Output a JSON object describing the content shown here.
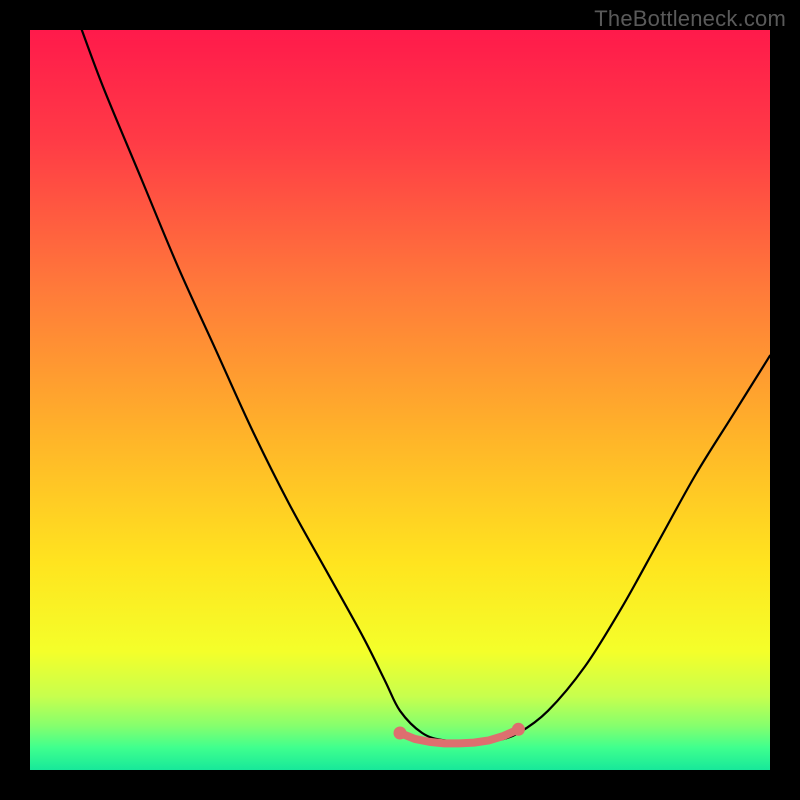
{
  "watermark": "TheBottleneck.com",
  "colors": {
    "frame": "#000000",
    "curve": "#000000",
    "marker_stroke": "#dd6f6f",
    "marker_fill": "#dd6f6f",
    "gradient_stops": [
      {
        "offset": 0.0,
        "color": "#ff1a4b"
      },
      {
        "offset": 0.15,
        "color": "#ff3b46"
      },
      {
        "offset": 0.35,
        "color": "#ff7a3a"
      },
      {
        "offset": 0.55,
        "color": "#ffb429"
      },
      {
        "offset": 0.72,
        "color": "#ffe41f"
      },
      {
        "offset": 0.84,
        "color": "#f4ff2a"
      },
      {
        "offset": 0.9,
        "color": "#c8ff4d"
      },
      {
        "offset": 0.94,
        "color": "#86ff6d"
      },
      {
        "offset": 0.97,
        "color": "#3fff8e"
      },
      {
        "offset": 1.0,
        "color": "#17e89a"
      }
    ]
  },
  "chart_data": {
    "type": "line",
    "title": "",
    "xlabel": "",
    "ylabel": "",
    "xlim": [
      0,
      100
    ],
    "ylim": [
      0,
      100
    ],
    "grid": false,
    "legend": false,
    "series": [
      {
        "name": "bottleneck-curve",
        "x": [
          7,
          10,
          15,
          20,
          25,
          30,
          35,
          40,
          45,
          48,
          50,
          53,
          56,
          60,
          63,
          66,
          70,
          75,
          80,
          85,
          90,
          95,
          100
        ],
        "y": [
          100,
          92,
          80,
          68,
          57,
          46,
          36,
          27,
          18,
          12,
          8,
          5,
          4,
          4,
          4,
          5,
          8,
          14,
          22,
          31,
          40,
          48,
          56
        ]
      }
    ],
    "markers": {
      "name": "trough-highlight",
      "color": "#dd6f6f",
      "points": [
        {
          "x": 50,
          "y": 5
        },
        {
          "x": 52,
          "y": 4.2
        },
        {
          "x": 54,
          "y": 3.8
        },
        {
          "x": 56,
          "y": 3.6
        },
        {
          "x": 58,
          "y": 3.6
        },
        {
          "x": 60,
          "y": 3.7
        },
        {
          "x": 62,
          "y": 4.0
        },
        {
          "x": 64,
          "y": 4.6
        },
        {
          "x": 66,
          "y": 5.5
        }
      ]
    },
    "annotations": []
  }
}
